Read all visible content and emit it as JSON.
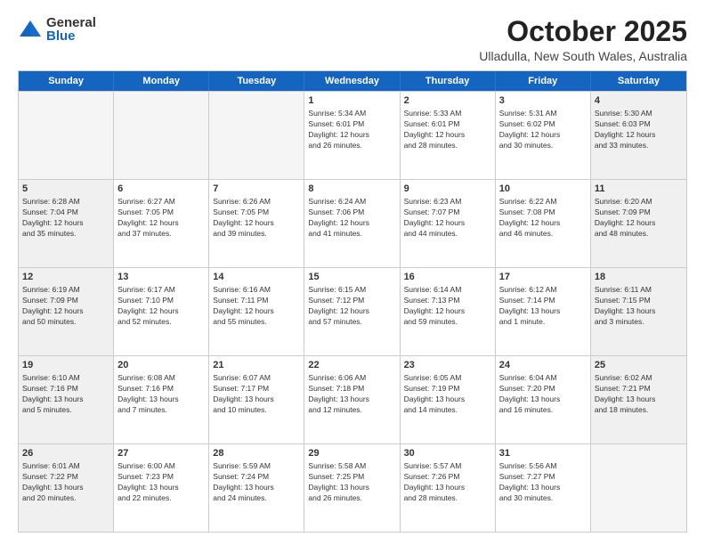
{
  "logo": {
    "general": "General",
    "blue": "Blue"
  },
  "title": "October 2025",
  "location": "Ulladulla, New South Wales, Australia",
  "header_days": [
    "Sunday",
    "Monday",
    "Tuesday",
    "Wednesday",
    "Thursday",
    "Friday",
    "Saturday"
  ],
  "rows": [
    [
      {
        "day": "",
        "info": "",
        "empty": true
      },
      {
        "day": "",
        "info": "",
        "empty": true
      },
      {
        "day": "",
        "info": "",
        "empty": true
      },
      {
        "day": "1",
        "info": "Sunrise: 5:34 AM\nSunset: 6:01 PM\nDaylight: 12 hours\nand 26 minutes."
      },
      {
        "day": "2",
        "info": "Sunrise: 5:33 AM\nSunset: 6:01 PM\nDaylight: 12 hours\nand 28 minutes."
      },
      {
        "day": "3",
        "info": "Sunrise: 5:31 AM\nSunset: 6:02 PM\nDaylight: 12 hours\nand 30 minutes."
      },
      {
        "day": "4",
        "info": "Sunrise: 5:30 AM\nSunset: 6:03 PM\nDaylight: 12 hours\nand 33 minutes.",
        "shaded": true
      }
    ],
    [
      {
        "day": "5",
        "info": "Sunrise: 6:28 AM\nSunset: 7:04 PM\nDaylight: 12 hours\nand 35 minutes.",
        "shaded": true
      },
      {
        "day": "6",
        "info": "Sunrise: 6:27 AM\nSunset: 7:05 PM\nDaylight: 12 hours\nand 37 minutes."
      },
      {
        "day": "7",
        "info": "Sunrise: 6:26 AM\nSunset: 7:05 PM\nDaylight: 12 hours\nand 39 minutes."
      },
      {
        "day": "8",
        "info": "Sunrise: 6:24 AM\nSunset: 7:06 PM\nDaylight: 12 hours\nand 41 minutes."
      },
      {
        "day": "9",
        "info": "Sunrise: 6:23 AM\nSunset: 7:07 PM\nDaylight: 12 hours\nand 44 minutes."
      },
      {
        "day": "10",
        "info": "Sunrise: 6:22 AM\nSunset: 7:08 PM\nDaylight: 12 hours\nand 46 minutes."
      },
      {
        "day": "11",
        "info": "Sunrise: 6:20 AM\nSunset: 7:09 PM\nDaylight: 12 hours\nand 48 minutes.",
        "shaded": true
      }
    ],
    [
      {
        "day": "12",
        "info": "Sunrise: 6:19 AM\nSunset: 7:09 PM\nDaylight: 12 hours\nand 50 minutes.",
        "shaded": true
      },
      {
        "day": "13",
        "info": "Sunrise: 6:17 AM\nSunset: 7:10 PM\nDaylight: 12 hours\nand 52 minutes."
      },
      {
        "day": "14",
        "info": "Sunrise: 6:16 AM\nSunset: 7:11 PM\nDaylight: 12 hours\nand 55 minutes."
      },
      {
        "day": "15",
        "info": "Sunrise: 6:15 AM\nSunset: 7:12 PM\nDaylight: 12 hours\nand 57 minutes."
      },
      {
        "day": "16",
        "info": "Sunrise: 6:14 AM\nSunset: 7:13 PM\nDaylight: 12 hours\nand 59 minutes."
      },
      {
        "day": "17",
        "info": "Sunrise: 6:12 AM\nSunset: 7:14 PM\nDaylight: 13 hours\nand 1 minute."
      },
      {
        "day": "18",
        "info": "Sunrise: 6:11 AM\nSunset: 7:15 PM\nDaylight: 13 hours\nand 3 minutes.",
        "shaded": true
      }
    ],
    [
      {
        "day": "19",
        "info": "Sunrise: 6:10 AM\nSunset: 7:16 PM\nDaylight: 13 hours\nand 5 minutes.",
        "shaded": true
      },
      {
        "day": "20",
        "info": "Sunrise: 6:08 AM\nSunset: 7:16 PM\nDaylight: 13 hours\nand 7 minutes."
      },
      {
        "day": "21",
        "info": "Sunrise: 6:07 AM\nSunset: 7:17 PM\nDaylight: 13 hours\nand 10 minutes."
      },
      {
        "day": "22",
        "info": "Sunrise: 6:06 AM\nSunset: 7:18 PM\nDaylight: 13 hours\nand 12 minutes."
      },
      {
        "day": "23",
        "info": "Sunrise: 6:05 AM\nSunset: 7:19 PM\nDaylight: 13 hours\nand 14 minutes."
      },
      {
        "day": "24",
        "info": "Sunrise: 6:04 AM\nSunset: 7:20 PM\nDaylight: 13 hours\nand 16 minutes."
      },
      {
        "day": "25",
        "info": "Sunrise: 6:02 AM\nSunset: 7:21 PM\nDaylight: 13 hours\nand 18 minutes.",
        "shaded": true
      }
    ],
    [
      {
        "day": "26",
        "info": "Sunrise: 6:01 AM\nSunset: 7:22 PM\nDaylight: 13 hours\nand 20 minutes.",
        "shaded": true
      },
      {
        "day": "27",
        "info": "Sunrise: 6:00 AM\nSunset: 7:23 PM\nDaylight: 13 hours\nand 22 minutes."
      },
      {
        "day": "28",
        "info": "Sunrise: 5:59 AM\nSunset: 7:24 PM\nDaylight: 13 hours\nand 24 minutes."
      },
      {
        "day": "29",
        "info": "Sunrise: 5:58 AM\nSunset: 7:25 PM\nDaylight: 13 hours\nand 26 minutes."
      },
      {
        "day": "30",
        "info": "Sunrise: 5:57 AM\nSunset: 7:26 PM\nDaylight: 13 hours\nand 28 minutes."
      },
      {
        "day": "31",
        "info": "Sunrise: 5:56 AM\nSunset: 7:27 PM\nDaylight: 13 hours\nand 30 minutes."
      },
      {
        "day": "",
        "info": "",
        "empty": true
      }
    ]
  ]
}
